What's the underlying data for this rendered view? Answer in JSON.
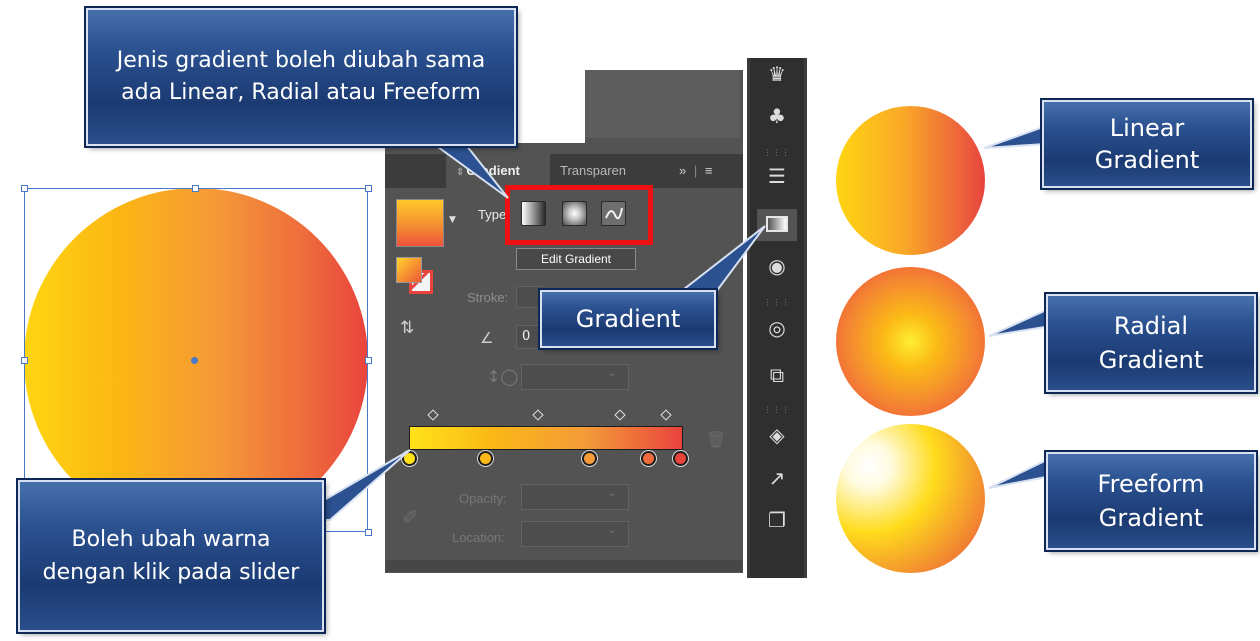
{
  "callouts": {
    "type_info": "Jenis gradient boleh diubah sama ada Linear, Radial atau Freeform",
    "gradient_tool": "Gradient",
    "slider_info": "Boleh ubah warna dengan klik pada slider",
    "linear": "Linear\nGradient",
    "radial": "Radial\nGradient",
    "freeform": "Freeform\nGradient"
  },
  "panel": {
    "tab_active": "Gradient",
    "tab_inactive": "Transparen",
    "overflow_label": "»",
    "menu_icon": "menu-icon",
    "type_label": "Type:",
    "edit_gradient_label": "Edit Gradient",
    "stroke_label": "Stroke:",
    "angle_value": "0",
    "opacity_label": "Opacity:",
    "location_label": "Location:",
    "gradient_types": [
      "linear",
      "radial",
      "freeform"
    ],
    "gradient_stops": [
      {
        "color": "#ffe21a"
      },
      {
        "color": "#fbb816"
      },
      {
        "color": "#f39a39"
      },
      {
        "color": "#ee6a3a"
      },
      {
        "color": "#e9433e"
      }
    ]
  },
  "colors": {
    "panel_bg": "#535353",
    "callout_blue": "#1b3a72",
    "highlight_red": "#ee1111",
    "grad_start": "#ffd511",
    "grad_end": "#e9433e"
  }
}
